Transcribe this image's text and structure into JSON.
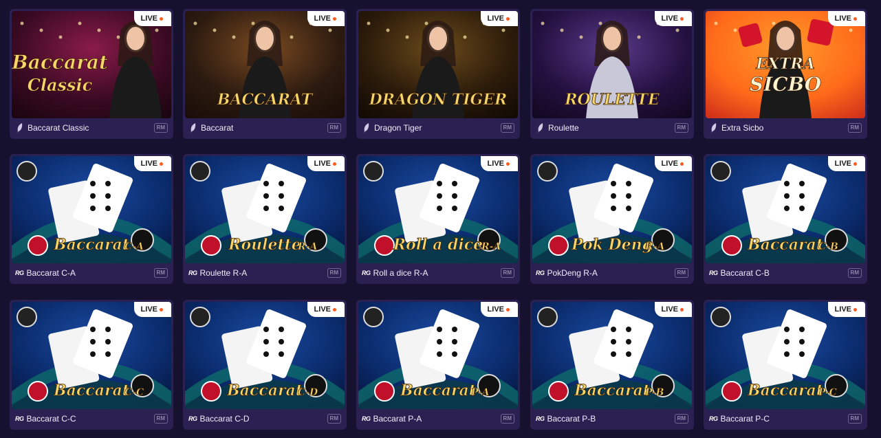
{
  "live_label": "LIVE",
  "rm_label": "RM",
  "rg_label": "RG",
  "rows": [
    [
      {
        "name": "Baccarat Classic",
        "provider": "feather",
        "art_title": "Baccarat",
        "art_sub": "Classic",
        "theme": "classic"
      },
      {
        "name": "Baccarat",
        "provider": "feather",
        "art_title": "BACCARAT",
        "art_sub": "",
        "theme": "gold"
      },
      {
        "name": "Dragon Tiger",
        "provider": "feather",
        "art_title": "DRAGON TIGER",
        "art_sub": "",
        "theme": "dragon"
      },
      {
        "name": "Roulette",
        "provider": "feather",
        "art_title": "ROULETTE",
        "art_sub": "",
        "theme": "purple"
      },
      {
        "name": "Extra Sicbo",
        "provider": "feather",
        "art_title": "EXTRA",
        "art_sub": "SICBO",
        "theme": "orange"
      }
    ],
    [
      {
        "name": "Baccarat C-A",
        "provider": "rg",
        "art_title": "Baccarat",
        "art_sub": "C-A",
        "theme": "blue"
      },
      {
        "name": "Roulette R-A",
        "provider": "rg",
        "art_title": "Roulette",
        "art_sub": "R-A",
        "theme": "blue"
      },
      {
        "name": "Roll a dice R-A",
        "provider": "rg",
        "art_title": "Roll a dice",
        "art_sub": "R-A",
        "theme": "blue"
      },
      {
        "name": "PokDeng R-A",
        "provider": "rg",
        "art_title": "Pok Deng",
        "art_sub": "R-A",
        "theme": "blue"
      },
      {
        "name": "Baccarat C-B",
        "provider": "rg",
        "art_title": "Baccarat",
        "art_sub": "C-B",
        "theme": "blue"
      }
    ],
    [
      {
        "name": "Baccarat C-C",
        "provider": "rg",
        "art_title": "Baccarat",
        "art_sub": "C-C",
        "theme": "blue"
      },
      {
        "name": "Baccarat C-D",
        "provider": "rg",
        "art_title": "Baccarat",
        "art_sub": "C-D",
        "theme": "blue"
      },
      {
        "name": "Baccarat P-A",
        "provider": "rg",
        "art_title": "Baccarat",
        "art_sub": "P-A",
        "theme": "blue"
      },
      {
        "name": "Baccarat P-B",
        "provider": "rg",
        "art_title": "Baccarat",
        "art_sub": "P-B",
        "theme": "blue"
      },
      {
        "name": "Baccarat P-C",
        "provider": "rg",
        "art_title": "Baccarat",
        "art_sub": "P-C",
        "theme": "blue"
      }
    ]
  ],
  "colors": {
    "page_bg": "#16112e",
    "card_bg": "#2a2152",
    "live_dot": "#ff5a1f",
    "art_gold": "#f5d66a"
  }
}
